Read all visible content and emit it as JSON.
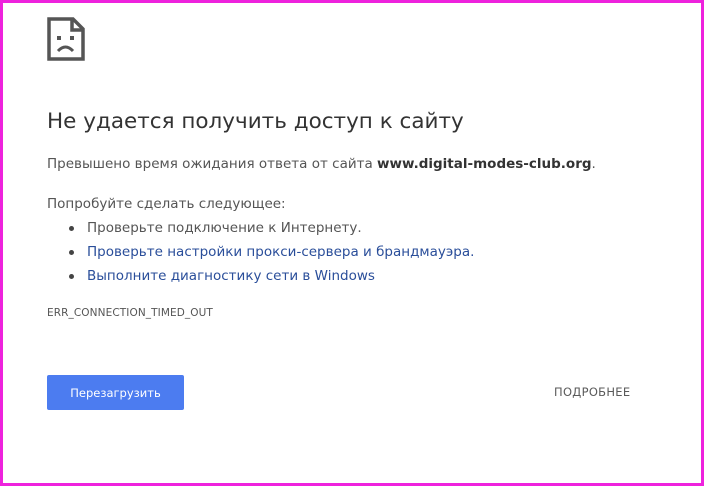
{
  "error_page": {
    "title": "Не удается получить доступ к сайту",
    "summary_prefix": "Превышено время ожидания ответа от сайта ",
    "site": "www.digital-modes-club.org",
    "summary_suffix": ".",
    "try_label": "Попробуйте сделать следующее:",
    "suggestions": [
      {
        "label": "Проверьте подключение к Интернету.",
        "is_link": false
      },
      {
        "label": "Проверьте настройки прокси-сервера и брандмауэра.",
        "is_link": true
      },
      {
        "label": "Выполните диагностику сети в Windows",
        "is_link": true
      }
    ],
    "error_code": "ERR_CONNECTION_TIMED_OUT",
    "reload_label": "Перезагрузить",
    "details_label": "ПОДРОБНЕЕ",
    "icon": "sad-page-icon"
  },
  "colors": {
    "frame_border": "#ee22dd",
    "link": "#2a4e9a",
    "primary_button": "#4c7cf0"
  }
}
